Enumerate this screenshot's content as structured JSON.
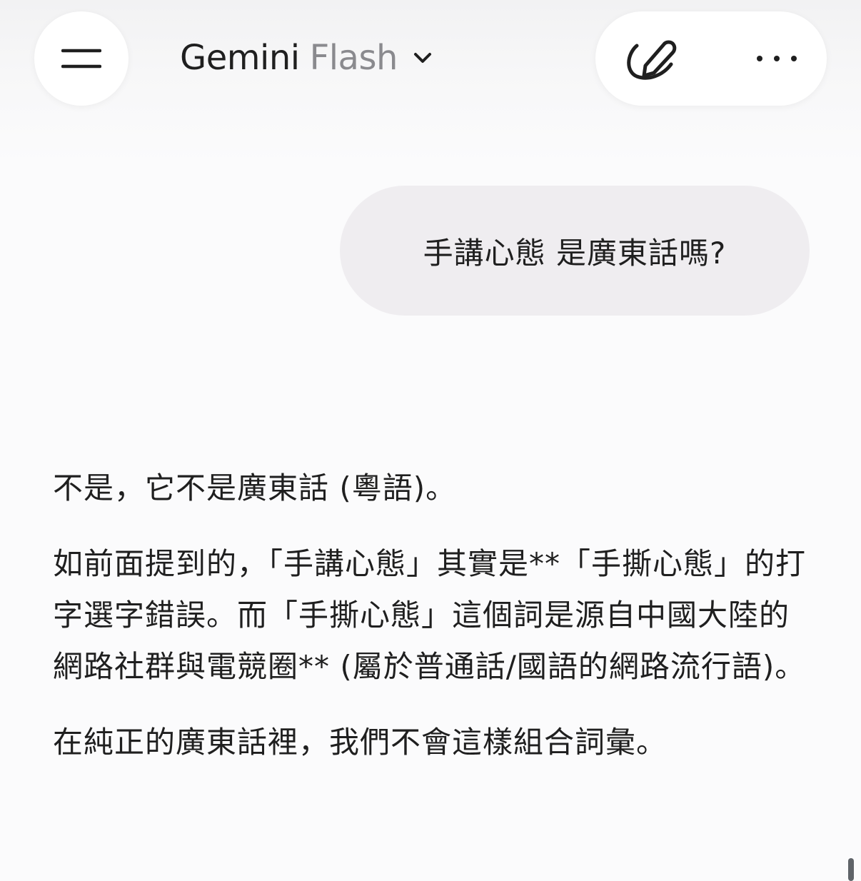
{
  "header": {
    "menu_icon": "menu-icon",
    "model_name": "Gemini",
    "model_variant": "Flash",
    "chevron_icon": "chevron-down-icon",
    "new_chat_icon": "pencil-edit-icon",
    "more_icon": "more-horizontal-icon"
  },
  "conversation": {
    "user_message": "手講心態 是廣東話嗎?",
    "response": {
      "paragraphs": [
        "不是，它不是廣東話 (粵語)。",
        "如前面提到的，「手講心態」其實是**「手撕心態」的打字選字錯誤。而「手撕心態」這個詞是源自中國大陸的網路社群與電競圈** (屬於普通話/國語的網路流行語)。",
        "在純正的廣東話裡，我們不會這樣組合詞彙。"
      ]
    }
  },
  "colors": {
    "background": "#fbfbfc",
    "bubble": "#efedf0",
    "text": "#1f1f1f",
    "muted": "#8a8a8e"
  }
}
